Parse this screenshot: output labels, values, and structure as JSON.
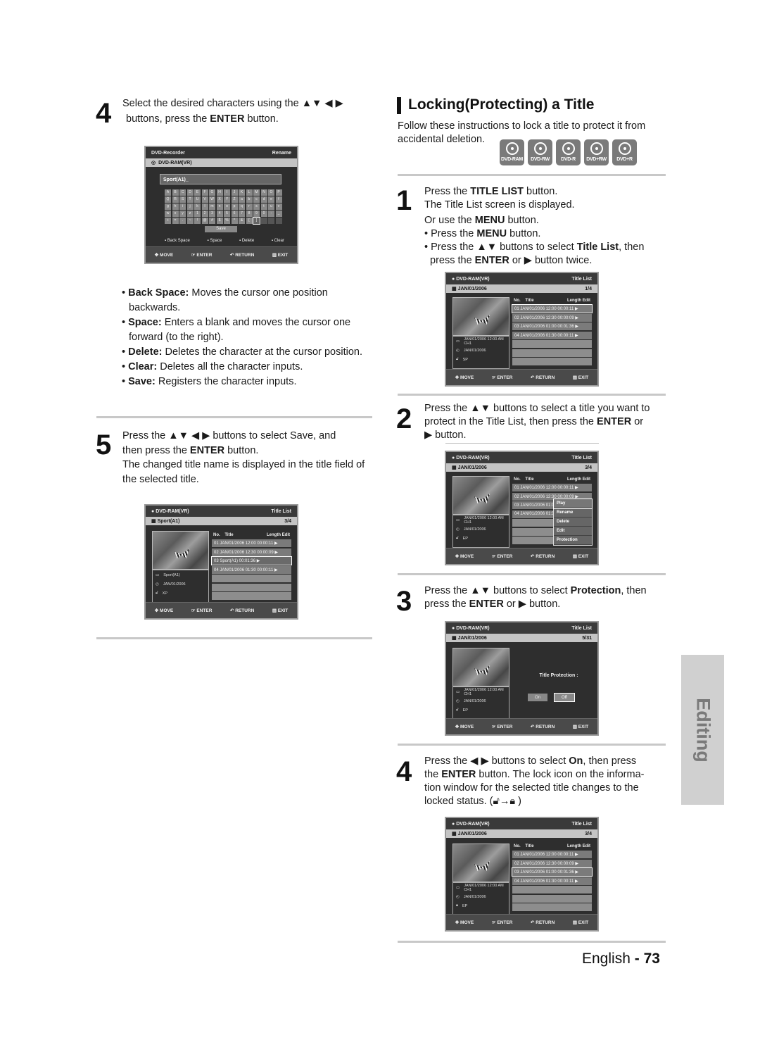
{
  "left": {
    "step4": {
      "num": "4",
      "line1_pre": "Select the desired characters using the ",
      "line1_arrows": "▲▼ ◀ ▶",
      "line2_pre": "buttons, press the ",
      "line2_bold": "ENTER",
      "line2_post": " button."
    },
    "rename_screen": {
      "header_left": "DVD-Recorder",
      "header_right": "Rename",
      "disc": "DVD-RAM(VR)",
      "input_value": "Sport(A1)_",
      "keys": [
        "A",
        "B",
        "C",
        "D",
        "E",
        "F",
        "G",
        "H",
        "I",
        "J",
        "K",
        "L",
        "M",
        "N",
        "O",
        "P",
        "Q",
        "R",
        "S",
        "T",
        "U",
        "V",
        "W",
        "X",
        "Y",
        "Z",
        "a",
        "b",
        "c",
        "d",
        "e",
        "f",
        "g",
        "h",
        "i",
        "j",
        "k",
        "l",
        "m",
        "n",
        "o",
        "p",
        "q",
        "r",
        "s",
        "t",
        "u",
        "v",
        "w",
        "x",
        "y",
        "z",
        "1",
        "2",
        "3",
        "4",
        "5",
        "6",
        "7",
        "8",
        "9",
        "0",
        "-",
        "_",
        "+",
        "=",
        ".",
        "~",
        "!",
        "@",
        "#",
        "$",
        "%",
        "^",
        "&",
        "[",
        "]",
        "",
        "",
        ""
      ],
      "selected_key": "]",
      "save": "Save",
      "functions": [
        "Back Space",
        "Space",
        "Delete",
        "Clear"
      ],
      "footer": [
        "MOVE",
        "ENTER",
        "RETURN",
        "EXIT"
      ]
    },
    "bullets": [
      {
        "term": "Back Space:",
        "desc": " Moves the cursor one position backwards."
      },
      {
        "term": "Space:",
        "desc": " Enters a blank and moves the cursor one forward (to the right)."
      },
      {
        "term": "Delete:",
        "desc": " Deletes the character at the cursor position."
      },
      {
        "term": "Clear:",
        "desc": " Deletes all the character inputs."
      },
      {
        "term": "Save:",
        "desc": " Registers the character inputs."
      }
    ],
    "step5": {
      "num": "5",
      "l1": "Press the ▲▼ ◀ ▶ buttons to select Save, and",
      "l2_pre": "then press the ",
      "l2_bold": "ENTER",
      "l2_post": " button.",
      "l3": "The changed title name is displayed in the title field of the selected title."
    },
    "title_list_screen": {
      "disc": "DVD-RAM(VR)",
      "header_right": "Title List",
      "title": "Sport(A1)",
      "count": "3/4",
      "cols": [
        "No.",
        "Title",
        "Length",
        "Edit"
      ],
      "rows": [
        "01 JAN/01/2006  12:00  00:00:11  ▶",
        "02 JAN/01/2006  12:30  00:00:09  ▶",
        "03 Sport(A1)                00:01:36  ▶",
        "04 JAN/01/2006  01:30  00:00:11  ▶"
      ],
      "selected_row": 2,
      "info": [
        "Sport(A1)",
        "JAN/01/2006",
        "XP"
      ],
      "footer": [
        "MOVE",
        "ENTER",
        "RETURN",
        "EXIT"
      ]
    }
  },
  "right": {
    "heading": "Locking(Protecting) a Title",
    "intro": "Follow these instructions to lock a title to protect it from accidental deletion.",
    "discs": [
      "DVD-RAM",
      "DVD-RW",
      "DVD-R",
      "DVD+RW",
      "DVD+R"
    ],
    "step1": {
      "num": "1",
      "l1_pre": "Press the ",
      "l1_bold": "TITLE LIST",
      "l1_post": " button.",
      "l2": "The Title List screen is displayed.",
      "l3_pre": "Or use the ",
      "l3_bold": "MENU",
      "l3_post": " button.",
      "b1_pre": "• Press the ",
      "b1_bold": "MENU",
      "b1_post": " button.",
      "b2_pre": "• Press the ▲▼ buttons to select ",
      "b2_bold": "Title List",
      "b2_post": ", then",
      "b3_pre": "press the ",
      "b3_bold": "ENTER",
      "b3_post": " or ▶ button twice."
    },
    "screen1": {
      "disc": "DVD-RAM(VR)",
      "header_right": "Title List",
      "title": "JAN/01/2006",
      "count": "1/4",
      "cols": [
        "No.",
        "Title",
        "Length",
        "Edit"
      ],
      "rows": [
        "01 JAN/01/2006  12:00  00:00:11  ▶",
        "02 JAN/01/2006  12:30  00:00:09  ▶",
        "03 JAN/01/2006  01:00  00:01:36  ▶",
        "04 JAN/01/2006  01:30  00:00:11  ▶"
      ],
      "info": [
        "JAN/01/2006 12:00 AM CH1",
        "JAN/01/2006",
        "SP"
      ],
      "footer": [
        "MOVE",
        "ENTER",
        "RETURN",
        "EXIT"
      ]
    },
    "step2": {
      "num": "2",
      "l1": "Press the ▲▼ buttons to select a title you want to",
      "l2_pre": "protect in the Title List, then press the ",
      "l2_bold": "ENTER",
      "l2_post": " or",
      "l3": "▶ button."
    },
    "screen2": {
      "disc": "DVD-RAM(VR)",
      "header_right": "Title List",
      "title": "JAN/01/2006",
      "count": "3/4",
      "cols": [
        "No.",
        "Title",
        "Length",
        "Edit"
      ],
      "rows": [
        "01 JAN/01/2006  12:00  00:00:11  ▶",
        "02 JAN/01/2006  12:30  00:00:09  ▶",
        "03 JAN/01/2006  01:00",
        "04 JAN/01/2006  01:30"
      ],
      "menu": [
        "Play",
        "Rename",
        "Delete",
        "Edit",
        "Protection"
      ],
      "info": [
        "JAN/01/2006 12:00 AM CH1",
        "JAN/01/2006",
        "EP"
      ],
      "footer": [
        "MOVE",
        "ENTER",
        "RETURN",
        "EXIT"
      ]
    },
    "step3": {
      "num": "3",
      "l1_pre": "Press the ▲▼ buttons to select ",
      "l1_bold": "Protection",
      "l1_post": ", then",
      "l2_pre": "press the ",
      "l2_bold": "ENTER",
      "l2_post": " or ▶ button."
    },
    "screen3": {
      "disc": "DVD-RAM(VR)",
      "header_right": "Title List",
      "title": "JAN/01/2006",
      "count": "5/31",
      "protection_label": "Title Protection :",
      "on": "On",
      "off": "Off",
      "info": [
        "JAN/01/2006 12:00 AM CH1",
        "JAN/01/2006",
        "EP"
      ],
      "footer": [
        "MOVE",
        "ENTER",
        "RETURN",
        "EXIT"
      ]
    },
    "step4": {
      "num": "4",
      "l1_pre": "Press the ◀ ▶ buttons to select ",
      "l1_bold": "On",
      "l1_post": ", then press",
      "l2_pre": "the ",
      "l2_bold": "ENTER",
      "l2_post": " button. The lock icon on the informa-",
      "l3": "tion window for the selected title changes to the",
      "l4": "locked status. (",
      "l4_end": " )"
    },
    "screen4": {
      "disc": "DVD-RAM(VR)",
      "header_right": "Title List",
      "title": "JAN/01/2006",
      "count": "3/4",
      "cols": [
        "No.",
        "Title",
        "Length",
        "Edit"
      ],
      "rows": [
        "01 JAN/01/2006  12:00  00:00:11  ▶",
        "02 JAN/01/2006  12:30  00:00:09  ▶",
        "03 JAN/01/2006  01:00  00:01:36  ▶",
        "04 JAN/01/2006  01:30  00:00:11  ▶"
      ],
      "info": [
        "JAN/01/2006 12:00 AM CH1",
        "JAN/01/2006",
        "EP"
      ],
      "footer": [
        "MOVE",
        "ENTER",
        "RETURN",
        "EXIT"
      ]
    }
  },
  "side_tab": "Editing",
  "footer": {
    "lang": "English",
    "sep": " - ",
    "page": "73"
  }
}
